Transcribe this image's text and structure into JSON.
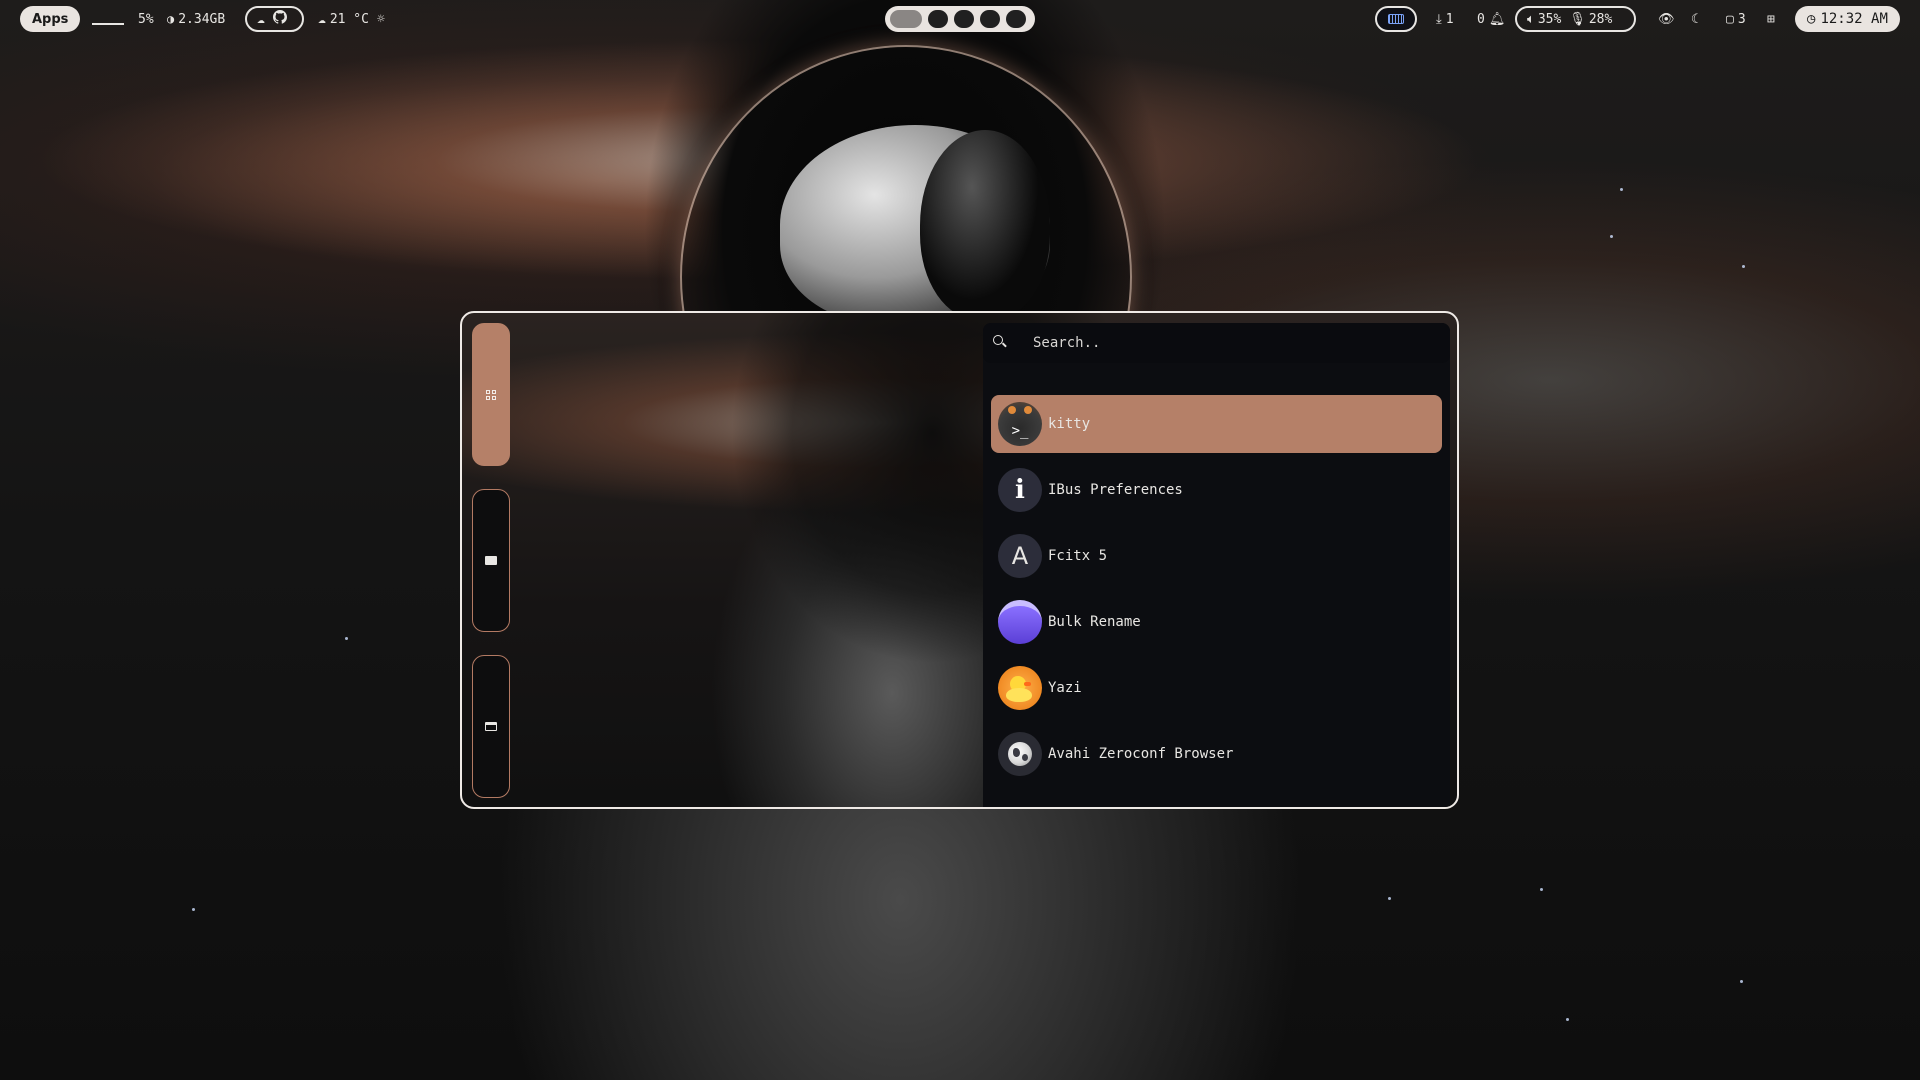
{
  "topbar": {
    "apps_label": "Apps",
    "cpu": "5%",
    "memory": "2.34GB",
    "weather_temp": "21 °C",
    "downloads_count": "1",
    "notifications_count": "0",
    "volume": "35%",
    "mic": "28%",
    "windows_count": "3",
    "clock": "12:32 AM"
  },
  "launcher": {
    "search_placeholder": "Search..",
    "results": [
      {
        "name": "kitty",
        "icon": "kitty-icon",
        "active": true
      },
      {
        "name": "IBus Preferences",
        "icon": "info-icon",
        "active": false
      },
      {
        "name": "Fcitx 5",
        "icon": "fcitx-icon",
        "icon_letter": "A",
        "active": false
      },
      {
        "name": "Bulk Rename",
        "icon": "folder-icon",
        "active": false
      },
      {
        "name": "Yazi",
        "icon": "duck-icon",
        "active": false
      },
      {
        "name": "Avahi Zeroconf Browser",
        "icon": "globe-icon",
        "active": false
      }
    ]
  },
  "colors": {
    "accent": "#b58068",
    "panel": "#0c0d11",
    "bar_pill": "#e9e4e0"
  }
}
